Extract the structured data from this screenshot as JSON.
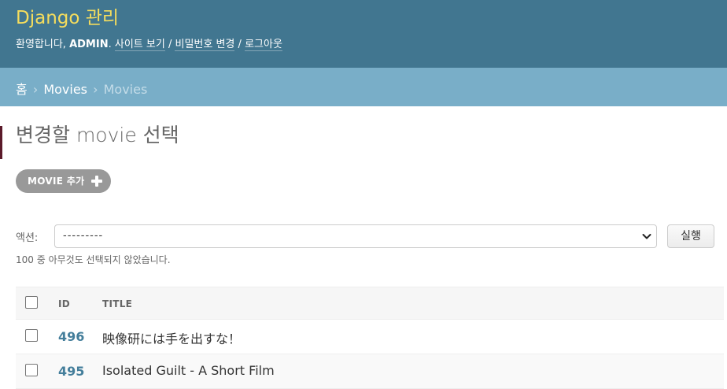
{
  "header": {
    "brand": "Django 관리",
    "welcome": "환영합니다,",
    "username": "ADMIN",
    "after_username": ".",
    "links": [
      "사이트 보기",
      "비밀번호 변경",
      "로그아웃"
    ],
    "separator": "/"
  },
  "breadcrumbs": {
    "home": "홈",
    "app": "Movies",
    "current": "Movies",
    "separator": "›"
  },
  "page": {
    "title": "변경할 movie 선택",
    "add_button": "MOVIE 추가"
  },
  "actions": {
    "label": "액션:",
    "selected": "---------",
    "run_button": "실행",
    "counter": "100 중 아무것도 선택되지 않았습니다."
  },
  "table": {
    "columns": [
      "ID",
      "TITLE"
    ],
    "rows": [
      {
        "id": "496",
        "title": "映像研には手を出すな！"
      },
      {
        "id": "495",
        "title": "Isolated Guilt - A Short Film"
      }
    ]
  },
  "colors": {
    "header_bg": "#417690",
    "brand": "#f5dd5d",
    "breadcrumb_bg": "#79aec8",
    "link": "#447e9b"
  }
}
